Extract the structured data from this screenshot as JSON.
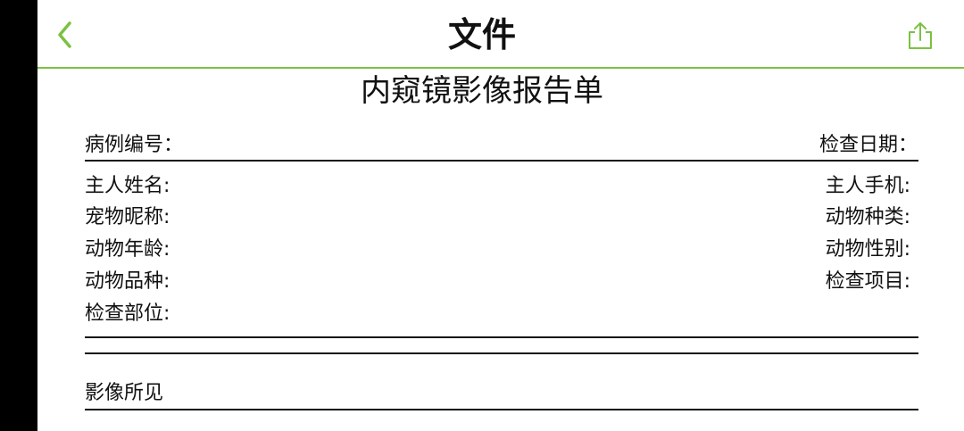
{
  "nav": {
    "title": "文件",
    "back_icon": "chevron-left-icon",
    "share_icon": "share-icon",
    "accent_color": "#7cc142"
  },
  "report": {
    "title": "内窥镜影像报告单",
    "case_number_label": "病例编号：",
    "exam_date_label": "检查日期：",
    "owner_name_label": "主人姓名:",
    "owner_phone_label": "主人手机:",
    "pet_name_label": "宠物昵称:",
    "species_label": "动物种类:",
    "age_label": "动物年龄:",
    "sex_label": "动物性别:",
    "breed_label": "动物品种:",
    "exam_item_label": "检查项目:",
    "exam_site_label": "检查部位:",
    "imaging_findings_label": "影像所见"
  }
}
